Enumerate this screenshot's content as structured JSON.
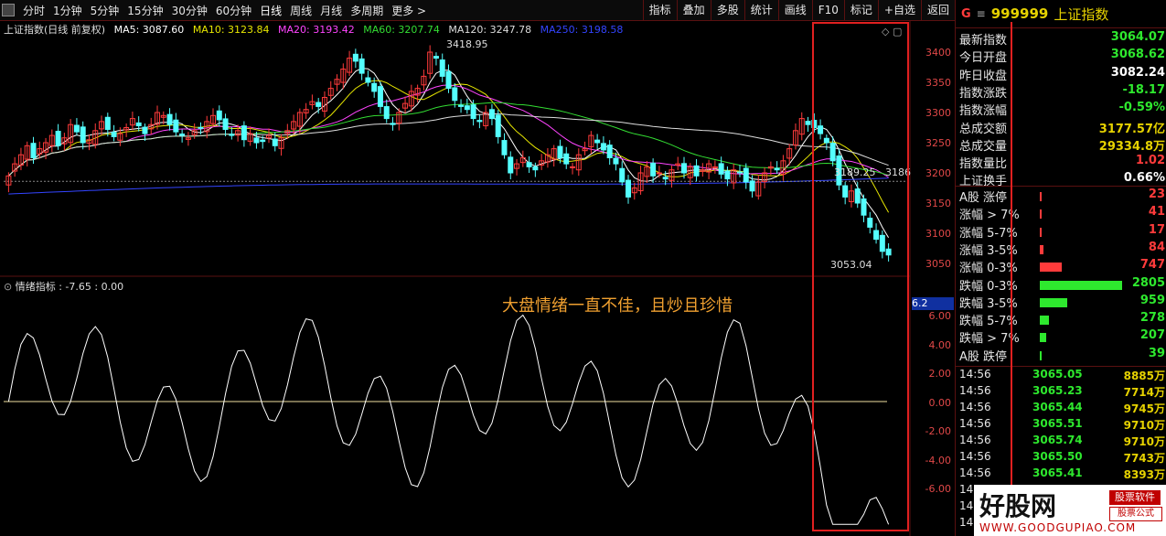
{
  "toolbar": {
    "left_items": [
      "分时",
      "1分钟",
      "5分钟",
      "15分钟",
      "30分钟",
      "60分钟",
      "日线",
      "周线",
      "月线",
      "多周期",
      "更多 >"
    ],
    "right_items": [
      "指标",
      "叠加",
      "多股",
      "统计",
      "画线",
      "F10",
      "标记",
      "+自选",
      "返回"
    ]
  },
  "main_legend": {
    "title": "上证指数(日线 前复权)",
    "ma5": "MA5: 3087.60",
    "ma10": "MA10: 3123.84",
    "ma20": "MA20: 3193.42",
    "ma60": "MA60: 3207.74",
    "ma120": "MA120: 3247.78",
    "ma250": "MA250: 3198.58"
  },
  "colors": {
    "ma5": "#ffffff",
    "ma10": "#e6e600",
    "ma20": "#ff44ff",
    "ma60": "#33dd33",
    "ma120": "#dddddd",
    "ma250": "#3344ff",
    "up": "#ff3b3b",
    "down": "#54ffff",
    "frame": "#5a1010",
    "highlight": "#e02020"
  },
  "price_axis": [
    "3400",
    "3350",
    "3300",
    "3250",
    "3200",
    "3150",
    "3100",
    "3050"
  ],
  "price_annotations": {
    "high": "3418.95",
    "low": "3053.04",
    "current": "3189.25",
    "side": "3186"
  },
  "indicator": {
    "legend": "情绪指标 : -7.65 : 0.00",
    "annotation": "大盘情绪一直不佳，且炒且珍惜",
    "marker": "6.2",
    "axis": [
      "6.00",
      "4.00",
      "2.00",
      "0.00",
      "-2.00",
      "-4.00",
      "-6.00"
    ]
  },
  "quote": {
    "code": "999999",
    "name": "上证指数",
    "stats": [
      {
        "k": "最新指数",
        "v": "3064.07",
        "c": "#2ee82e"
      },
      {
        "k": "今日开盘",
        "v": "3068.62",
        "c": "#2ee82e"
      },
      {
        "k": "昨日收盘",
        "v": "3082.24",
        "c": "#ffffff"
      },
      {
        "k": "指数涨跌",
        "v": "-18.17",
        "c": "#2ee82e"
      },
      {
        "k": "指数涨幅",
        "v": "-0.59%",
        "c": "#2ee82e"
      },
      {
        "k": "总成交额",
        "v": "3177.57亿",
        "c": "#e6d200"
      },
      {
        "k": "总成交量",
        "v": "29334.8万",
        "c": "#e6d200"
      },
      {
        "k": "指数量比",
        "v": "1.02",
        "c": "#ff3b3b"
      },
      {
        "k": "上证换手",
        "v": "0.66%",
        "c": "#ffffff"
      }
    ],
    "distribution": [
      {
        "k": "A股 涨停",
        "v": "23",
        "c": "#ff3b3b",
        "w": 2
      },
      {
        "k": "涨幅 > 7%",
        "v": "41",
        "c": "#ff3b3b",
        "w": 2
      },
      {
        "k": "涨幅 5-7%",
        "v": "17",
        "c": "#ff3b3b",
        "w": 2
      },
      {
        "k": "涨幅 3-5%",
        "v": "84",
        "c": "#ff3b3b",
        "w": 4
      },
      {
        "k": "涨幅 0-3%",
        "v": "747",
        "c": "#ff3b3b",
        "w": 24
      },
      {
        "k": "跌幅 0-3%",
        "v": "2805",
        "c": "#2ee82e",
        "w": 90
      },
      {
        "k": "跌幅 3-5%",
        "v": "959",
        "c": "#2ee82e",
        "w": 30
      },
      {
        "k": "跌幅 5-7%",
        "v": "278",
        "c": "#2ee82e",
        "w": 10
      },
      {
        "k": "跌幅 > 7%",
        "v": "207",
        "c": "#2ee82e",
        "w": 7
      },
      {
        "k": "A股 跌停",
        "v": "39",
        "c": "#2ee82e",
        "w": 2
      }
    ],
    "ticks": [
      {
        "t": "14:56",
        "p": "3065.05",
        "vol": "8885万"
      },
      {
        "t": "14:56",
        "p": "3065.23",
        "vol": "7714万"
      },
      {
        "t": "14:56",
        "p": "3065.44",
        "vol": "9745万"
      },
      {
        "t": "14:56",
        "p": "3065.51",
        "vol": "9710万"
      },
      {
        "t": "14:56",
        "p": "3065.74",
        "vol": "9710万"
      },
      {
        "t": "14:56",
        "p": "3065.50",
        "vol": "7743万"
      },
      {
        "t": "14:56",
        "p": "3065.41",
        "vol": "8393万"
      },
      {
        "t": "14:5",
        "p": "",
        "vol": ""
      },
      {
        "t": "14:5",
        "p": "",
        "vol": ""
      },
      {
        "t": "14:5",
        "p": "",
        "vol": ""
      }
    ]
  },
  "watermark": {
    "brand": "好股网",
    "tag1": "股票软件",
    "tag2": "股票公式",
    "url": "WWW.GOODGUPIAO.COM"
  }
}
